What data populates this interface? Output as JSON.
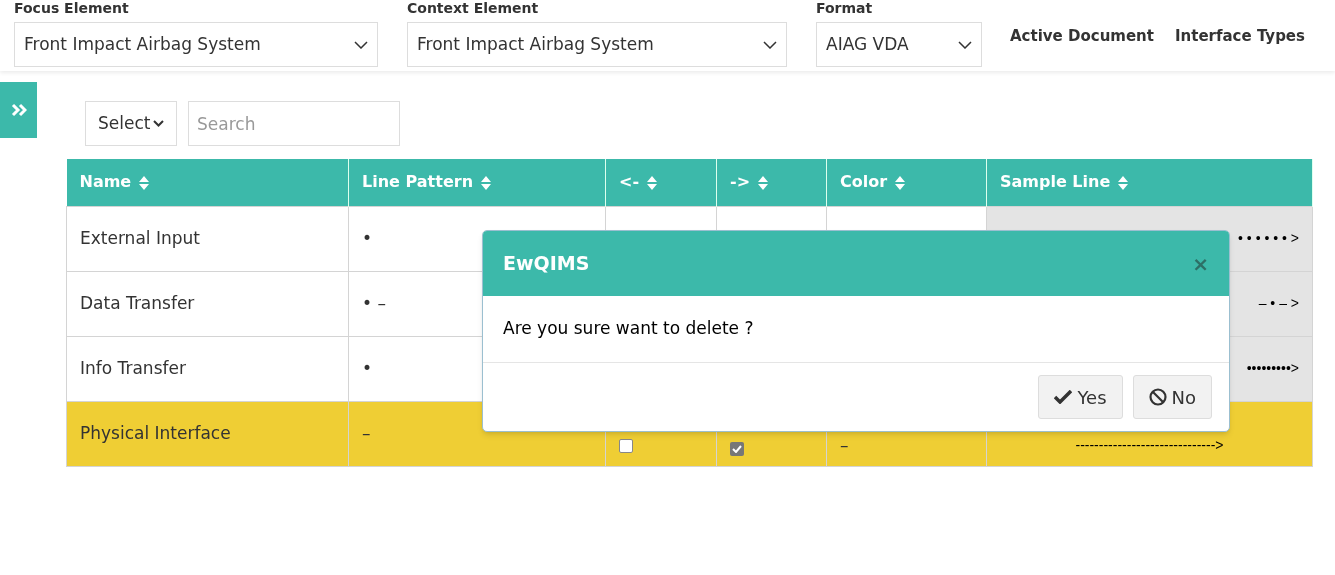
{
  "filters": [
    {
      "label": "Focus Element",
      "value": "Front Impact Airbag System"
    },
    {
      "label": "Context Element",
      "value": "Front Impact Airbag System"
    },
    {
      "label": "Format",
      "value": "AIAG VDA"
    }
  ],
  "nav_links": [
    "Active Document",
    "Interface Types"
  ],
  "toolbar": {
    "select": "Select",
    "search_placeholder": "Search"
  },
  "table": {
    "columns": [
      "Name",
      "Line Pattern",
      "<-",
      "->",
      "Color",
      "Sample Line"
    ],
    "rows": [
      {
        "name": "External Input",
        "line_pattern": "•",
        "sample_line": "• • • • • • >",
        "selected": false
      },
      {
        "name": "Data Transfer",
        "line_pattern": "• –",
        "sample_line": "– • – >",
        "selected": false
      },
      {
        "name": "Info Transfer",
        "line_pattern": "•",
        "sample_line": "•••••••••>",
        "selected": false
      },
      {
        "name": "Physical Interface",
        "line_pattern": "–",
        "left_arrow": false,
        "right_arrow": true,
        "color_column": "–",
        "sample_line": "------------------------------>",
        "selected": true
      }
    ]
  },
  "dialog": {
    "title": "EwQIMS",
    "close": "×",
    "message": "Are you sure want to delete ?",
    "buttons": [
      {
        "kind": "yes",
        "label": "Yes"
      },
      {
        "kind": "no",
        "label": "No"
      }
    ]
  }
}
